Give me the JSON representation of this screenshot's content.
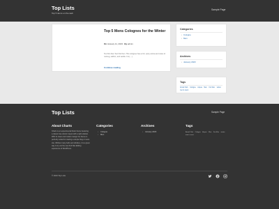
{
  "header": {
    "title": "Top Lists",
    "tagline": "Top 5 items on the web",
    "nav": "Sample Page"
  },
  "post": {
    "title": "Top 5 Mens Colognes for the Winter",
    "meta_on": "On",
    "date": "January 11, 2023",
    "meta_by": "By",
    "author": "admin",
    "excerpt": "Text first then Text first then. This colognes has a rich, spicy aroma and notes of nutmeg, saffron, and vanilla. It is […]",
    "read_more": "Continue reading"
  },
  "sidebar": {
    "categories": {
      "title": "Categories",
      "items": [
        "Cologne",
        "Men"
      ]
    },
    "archives": {
      "title": "Archives",
      "items": [
        "January 2023"
      ]
    },
    "tags": {
      "title": "Tags",
      "items": [
        "Armaf Club",
        "Cologne",
        "Acqua",
        "Men",
        "For Men",
        "winter",
        "men's scent"
      ]
    }
  },
  "footer": {
    "title": "Top Lists",
    "nav": "Sample Page",
    "about": {
      "title": "About Charts",
      "text": "Charts is an experimental block theme featuring a classic two-column layout with a right sidebar. With its clean and modern design the theme is perfectly suited for starting a simple blog or news site. Without many bells and whistles, it is a great way to try out the new Full Site Editing experience of WordPress."
    },
    "categories": {
      "title": "Categories",
      "items": [
        "Cologne",
        "Men"
      ]
    },
    "archives": {
      "title": "Archives",
      "items": [
        "January 2023"
      ]
    },
    "tags": {
      "title": "Tags",
      "items": [
        "Armaf Club",
        "Cologne",
        "Acqua",
        "Men",
        "For Men",
        "winter",
        "men's scent"
      ]
    },
    "copyright": "© 2023 Top Lists",
    "social": [
      {
        "icon": "twitter-icon"
      },
      {
        "icon": "facebook-icon"
      },
      {
        "icon": "instagram-icon"
      }
    ]
  },
  "colors": {
    "header_bg": "#333333",
    "page_bg": "#e9e9e9",
    "link": "#2a6fb0"
  }
}
